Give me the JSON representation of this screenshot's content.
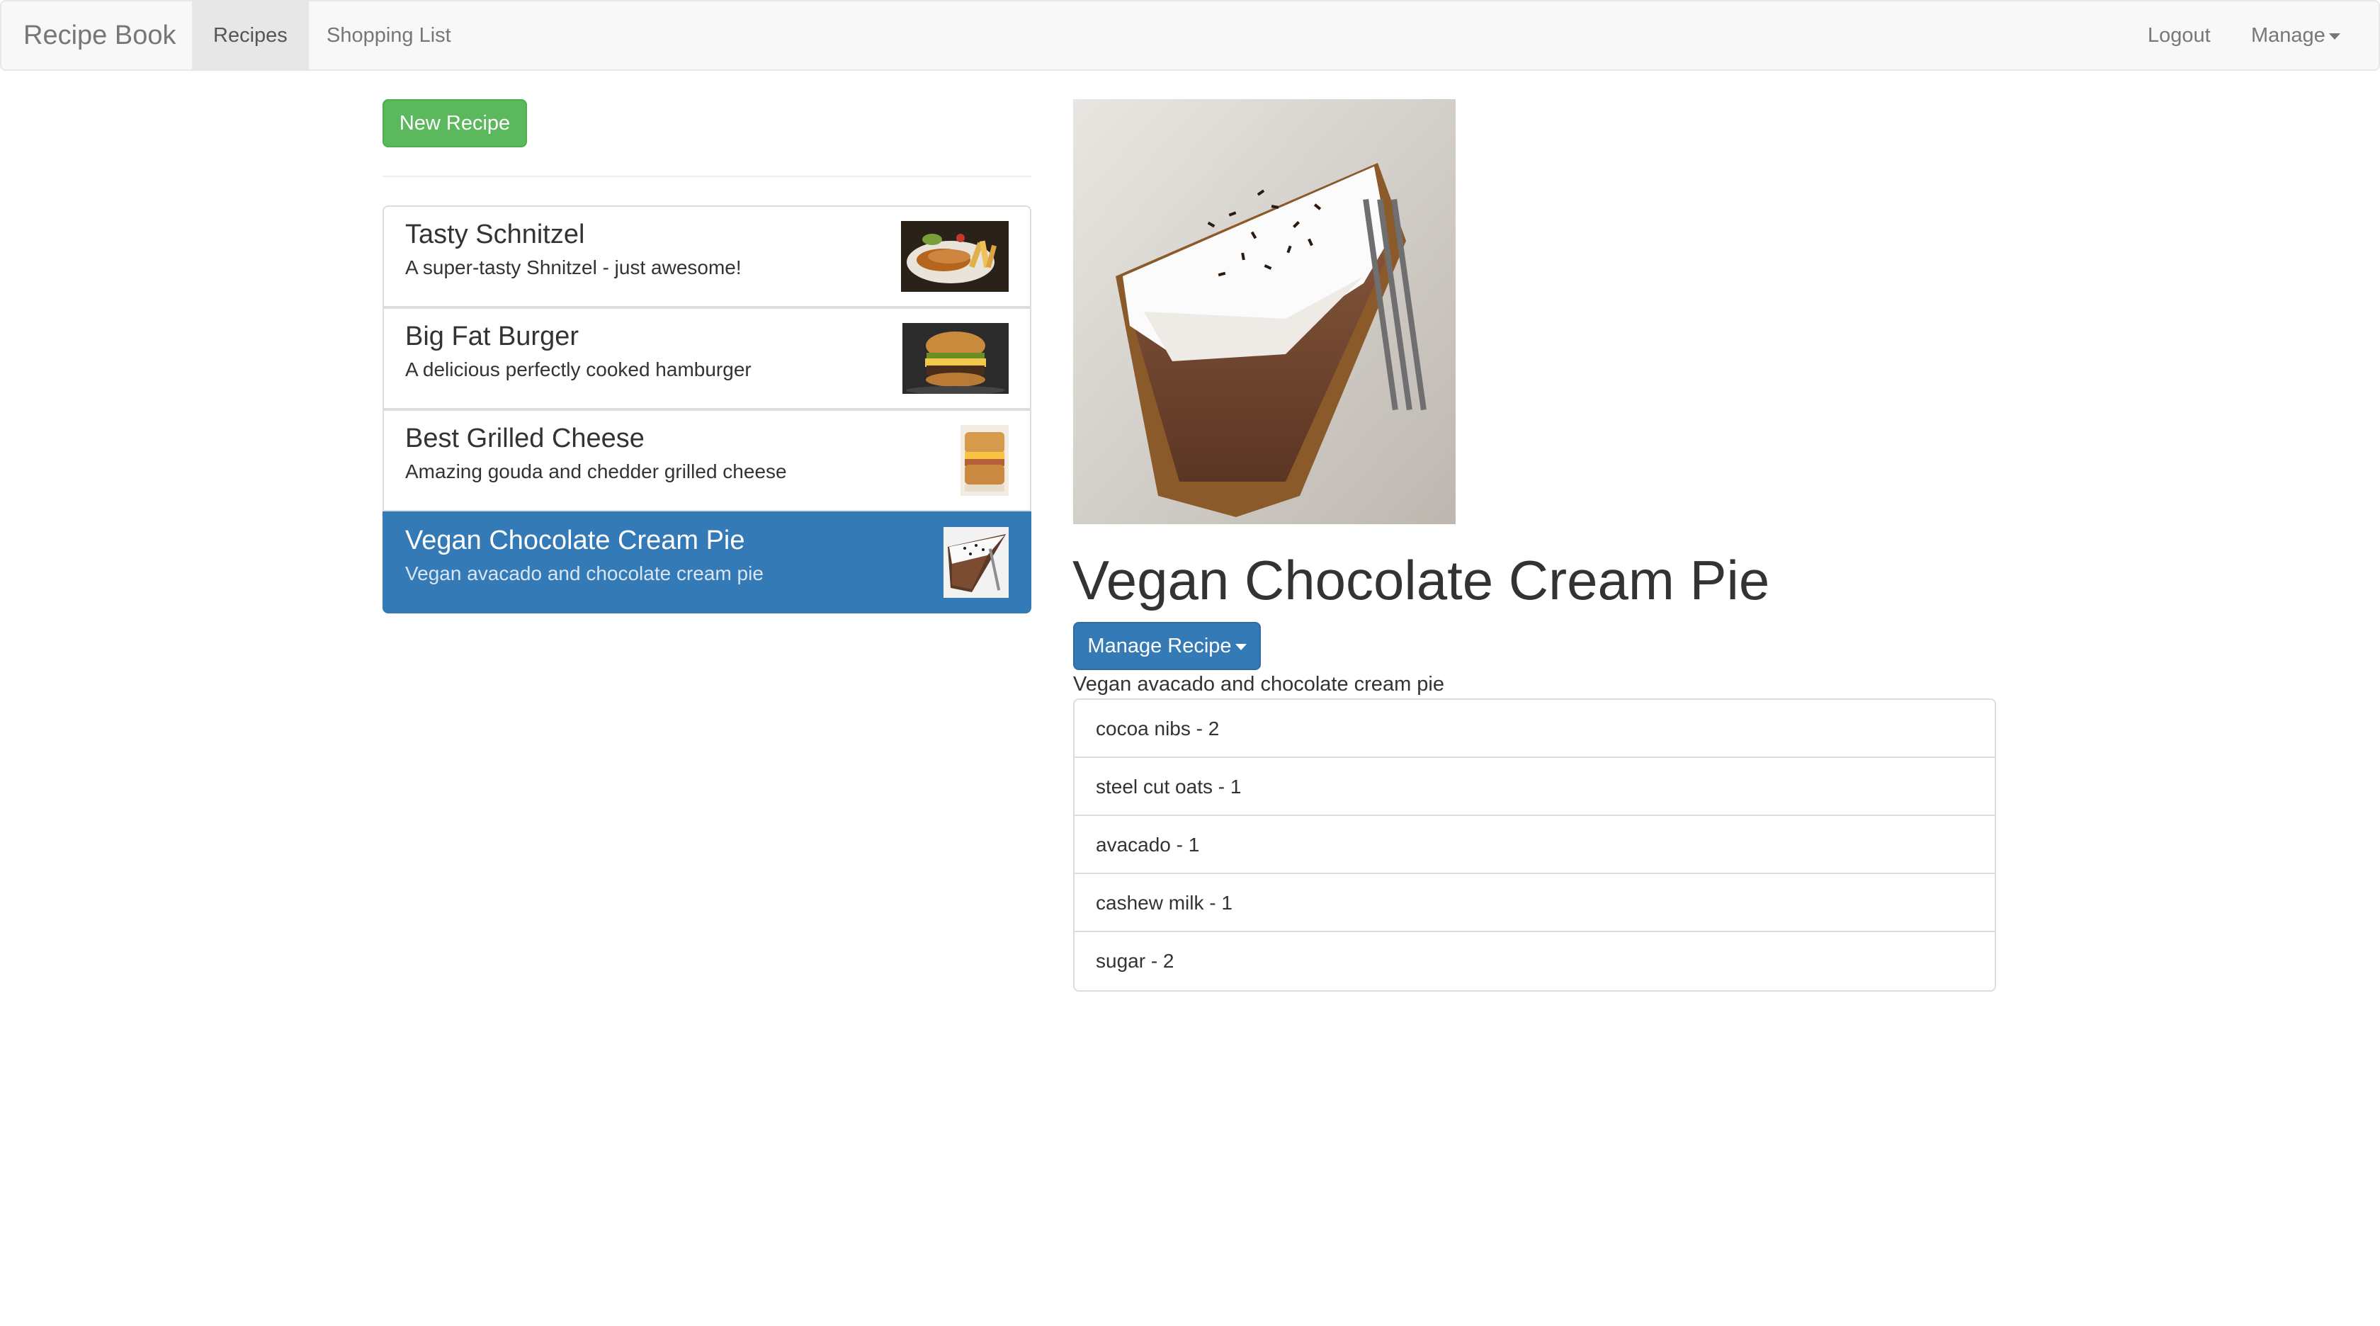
{
  "navbar": {
    "brand": "Recipe Book",
    "links": [
      "Recipes",
      "Shopping List"
    ],
    "logout": "Logout",
    "manage": "Manage"
  },
  "sidebar": {
    "new_recipe_label": "New Recipe",
    "recipes": [
      {
        "name": "Tasty Schnitzel",
        "description": "A super-tasty Shnitzel - just awesome!"
      },
      {
        "name": "Big Fat Burger",
        "description": "A delicious perfectly cooked hamburger"
      },
      {
        "name": "Best Grilled Cheese",
        "description": "Amazing gouda and chedder grilled cheese"
      },
      {
        "name": "Vegan Chocolate Cream Pie",
        "description": "Vegan avacado and chocolate cream pie"
      }
    ],
    "selected_index": 3
  },
  "detail": {
    "title": "Vegan Chocolate Cream Pie",
    "manage_label": "Manage Recipe",
    "description": "Vegan avacado and chocolate cream pie",
    "ingredients": [
      "cocoa nibs - 2",
      "steel cut oats - 1",
      "avacado - 1",
      "cashew milk - 1",
      "sugar - 2"
    ]
  },
  "colors": {
    "navbar_bg": "#f8f8f8",
    "success": "#5cb85c",
    "primary": "#337ab7"
  }
}
